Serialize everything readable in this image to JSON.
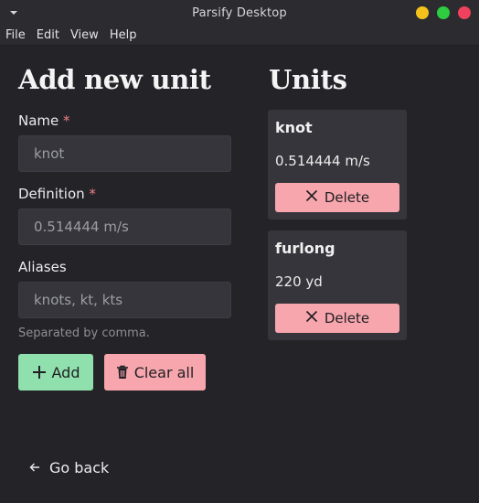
{
  "window": {
    "title": "Parsify Desktop",
    "controls": [
      {
        "name": "minimize",
        "color": "#f5c21b"
      },
      {
        "name": "maximize",
        "color": "#2ecc40"
      },
      {
        "name": "close",
        "color": "#f0425c"
      }
    ]
  },
  "menubar": {
    "items": [
      "File",
      "Edit",
      "View",
      "Help"
    ]
  },
  "form": {
    "title": "Add new unit",
    "name_label": "Name",
    "name_placeholder": "knot",
    "definition_label": "Definition",
    "definition_placeholder": "0.514444 m/s",
    "aliases_label": "Aliases",
    "aliases_placeholder": "knots, kt, kts",
    "aliases_hint": "Separated by comma.",
    "required_marker": "*",
    "add_label": "Add",
    "clear_label": "Clear all"
  },
  "units": {
    "title": "Units",
    "delete_label": "Delete",
    "items": [
      {
        "name": "knot",
        "definition": "0.514444 m/s"
      },
      {
        "name": "furlong",
        "definition": "220 yd"
      }
    ]
  },
  "footer": {
    "back_label": "Go back"
  },
  "colors": {
    "background": "#232328",
    "surface": "#35353b",
    "accent_add": "#8fe0ad",
    "accent_danger": "#f7a6ad",
    "required": "#f07f86"
  }
}
